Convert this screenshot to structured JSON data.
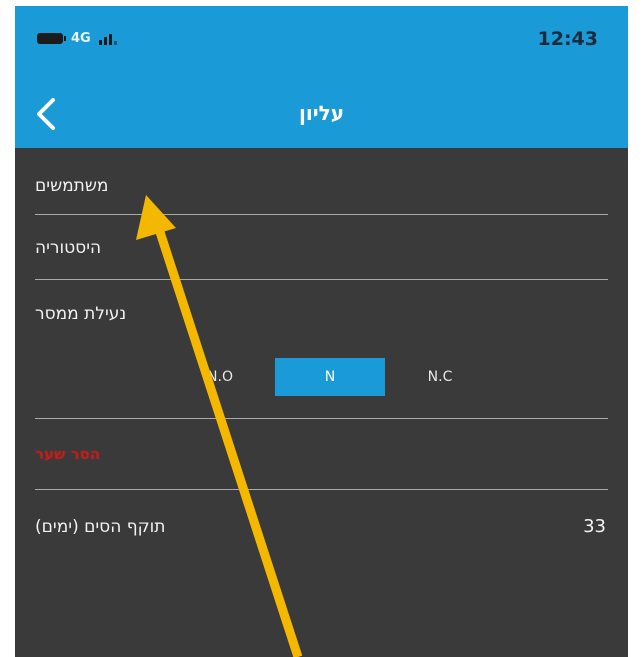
{
  "status_bar": {
    "network": "4G",
    "time": "12:43"
  },
  "nav": {
    "title": "עליון",
    "back_icon": "chevron-left-icon"
  },
  "menu": {
    "users_label": "משתמשים",
    "history_label": "היסטוריה",
    "relay_lock_label": "נעילת ממסר",
    "relay_options": [
      "N.O",
      "N",
      "N.C"
    ],
    "relay_selected": "N",
    "danger_action_label": "הסר שער",
    "sim_validity_label": "תוקף הסים (ימים)",
    "sim_validity_value": "33"
  },
  "colors": {
    "accent": "#1a9ad6",
    "background": "#3a3a3a",
    "danger": "#d31a1a",
    "annotation_arrow": "#f5b800"
  }
}
